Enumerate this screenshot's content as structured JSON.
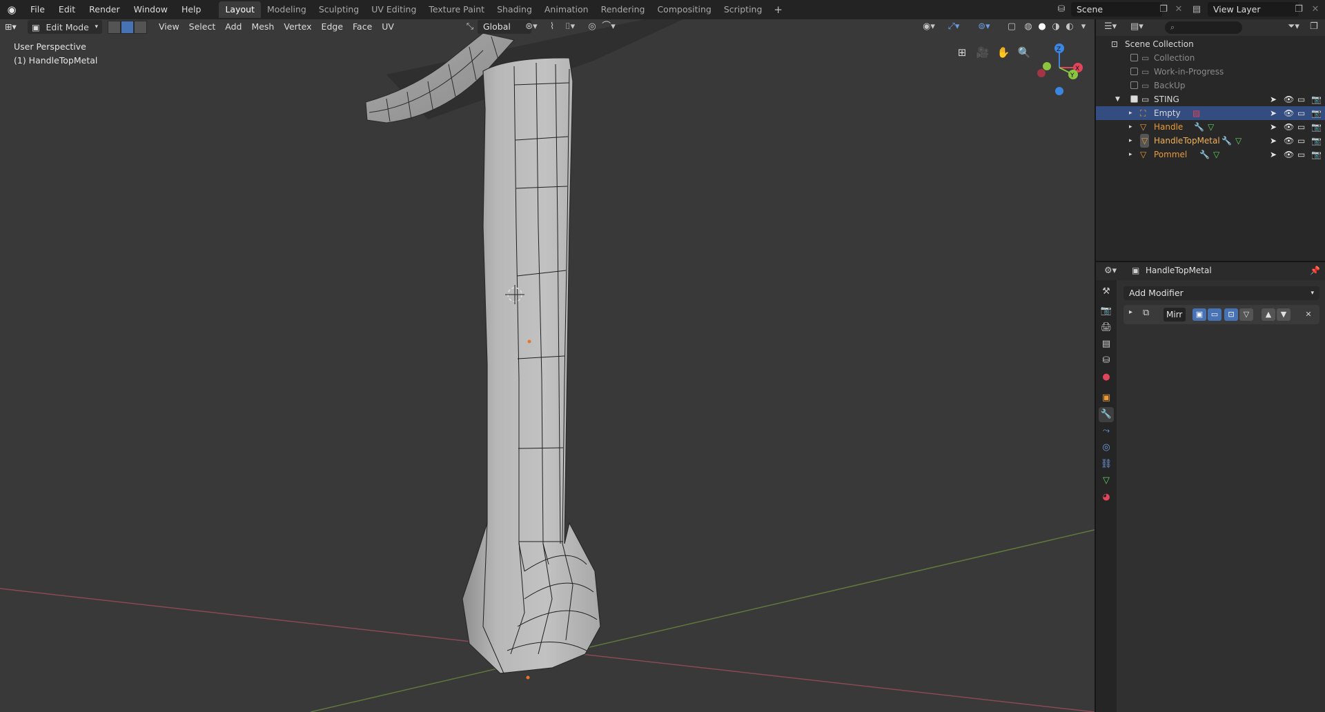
{
  "menu": [
    "File",
    "Edit",
    "Render",
    "Window",
    "Help"
  ],
  "workspaces": [
    {
      "label": "Layout",
      "active": true
    },
    {
      "label": "Modeling"
    },
    {
      "label": "Sculpting"
    },
    {
      "label": "UV Editing"
    },
    {
      "label": "Texture Paint"
    },
    {
      "label": "Shading"
    },
    {
      "label": "Animation"
    },
    {
      "label": "Rendering"
    },
    {
      "label": "Compositing"
    },
    {
      "label": "Scripting"
    }
  ],
  "add_workspace": "+",
  "scene": "Scene",
  "view_layer": "View Layer",
  "viewport": {
    "mode": "Edit Mode",
    "menus": [
      "View",
      "Select",
      "Add",
      "Mesh",
      "Vertex",
      "Edge",
      "Face",
      "UV"
    ],
    "transform_orientation": "Global",
    "perspective_label": "User Perspective",
    "object_label": "(1) HandleTopMetal",
    "gizmo_axes": {
      "x": "X",
      "y": "Y",
      "z": "Z"
    }
  },
  "outliner": {
    "search_placeholder": "",
    "rows": [
      {
        "label": "Scene Collection",
        "kind": "scene-collection"
      },
      {
        "label": "Collection",
        "kind": "collection",
        "dim": true
      },
      {
        "label": "Work-in-Progress",
        "kind": "collection",
        "dim": true
      },
      {
        "label": "BackUp",
        "kind": "collection",
        "dim": true
      },
      {
        "label": "STING",
        "kind": "collection",
        "checked": true
      },
      {
        "label": "Empty",
        "kind": "empty",
        "selected": true
      },
      {
        "label": "Handle",
        "kind": "mesh"
      },
      {
        "label": "HandleTopMetal",
        "kind": "mesh",
        "active": true
      },
      {
        "label": "Pommel",
        "kind": "mesh"
      }
    ]
  },
  "properties": {
    "object_name": "HandleTopMetal",
    "add_modifier": "Add Modifier",
    "modifier_name": "Mirr"
  },
  "colors": {
    "accent": "#4772b3",
    "selection": "#334d80",
    "object_orange": "#e99a3b",
    "x_axis": "#e0455a",
    "y_axis": "#8bc43f",
    "z_axis": "#3b86e3"
  }
}
